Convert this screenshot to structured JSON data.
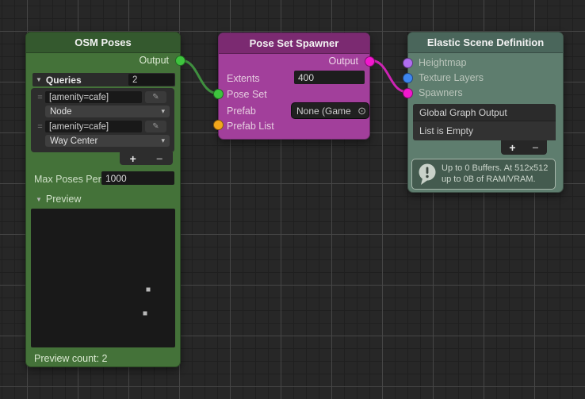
{
  "icons": {
    "foldout": "▼",
    "dropdown_arrow": "▾",
    "add": "+",
    "remove": "−",
    "object_picker": "⊙",
    "query_edit": "✎",
    "drag_handle": "="
  },
  "colors": {
    "background": "#272727",
    "grid_minor": "#1f1f1f",
    "grid_major": "#464646",
    "osm_header": "#34592e",
    "osm_body": "#447239",
    "spawner_header": "#7b2a71",
    "spawner_body": "#a23f9b",
    "elastic_header": "#4a665b",
    "elastic_body": "#5e7d6e",
    "port_green": "#3ec43e",
    "port_magenta": "#f218ce",
    "port_orange": "#f2a71b",
    "port_violet": "#b06ef0",
    "port_blue": "#3d86f0",
    "wire_green": "#3f8f3f",
    "wire_magenta": "#ce24b4"
  },
  "nodes": {
    "osm": {
      "title": "OSM Poses",
      "output_label": "Output",
      "queries_label": "Queries",
      "queries_count": "2",
      "query_rows": [
        {
          "value": "[amenity=cafe]",
          "type": "Node"
        },
        {
          "value": "[amenity=cafe]",
          "type": "Way Center"
        }
      ],
      "max_poses_label": "Max Poses Per",
      "max_poses_value": "1000",
      "preview_label": "Preview",
      "preview_count": "Preview count: 2"
    },
    "spawner": {
      "title": "Pose Set Spawner",
      "output_label": "Output",
      "extents_label": "Extents",
      "extents_value": "400",
      "pose_set_label": "Pose Set",
      "prefab_label": "Prefab",
      "prefab_value": "None (Game",
      "prefab_list_label": "Prefab List"
    },
    "elastic": {
      "title": "Elastic Scene Definition",
      "ports": [
        {
          "label": "Heightmap",
          "color": "#b06ef0"
        },
        {
          "label": "Texture Layers",
          "color": "#3d86f0"
        },
        {
          "label": "Spawners",
          "color": "#f218ce"
        }
      ],
      "list_header": "Global Graph Output",
      "list_empty_label": "List is Empty",
      "info_text": "Up to 0 Buffers. At 512x512 up to 0B of RAM/VRAM."
    }
  }
}
